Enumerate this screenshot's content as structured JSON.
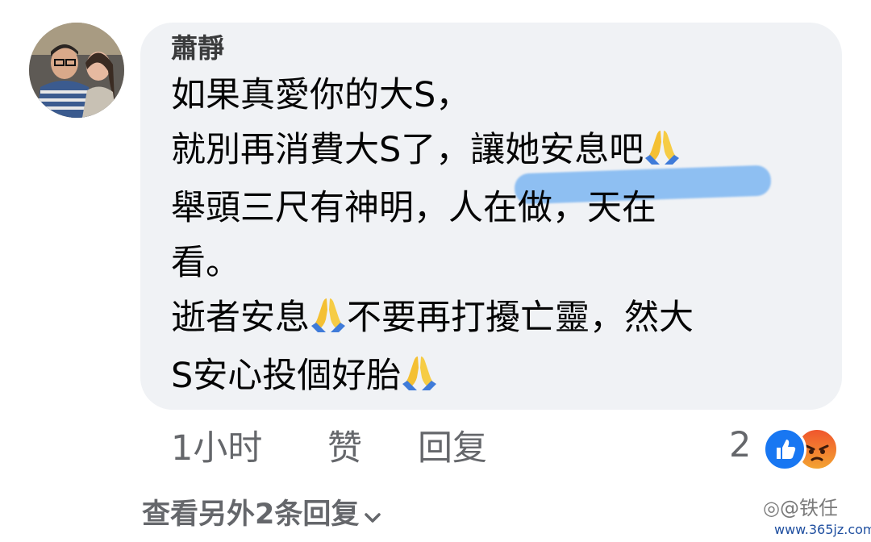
{
  "comment": {
    "author": "蕭靜",
    "lines": {
      "l1": "如果真愛你的大S，",
      "l2": "就別再消費大S了，讓她安息吧",
      "l3": "舉頭三尺有神明，人在做，天在",
      "l4": "看。",
      "l5a": "逝者安息",
      "l5b": "不要再打擾亡靈，然大",
      "l6": "S安心投個好胎"
    },
    "emoji_icon": "folded-hands-icon",
    "highlight_color": "#3e96f0"
  },
  "actions": {
    "time": "1小时",
    "like": "赞",
    "reply": "回复"
  },
  "reactions": {
    "count": "2",
    "icons": [
      "like-icon",
      "angry-icon"
    ]
  },
  "more_replies": {
    "label": "查看另外2条回复"
  },
  "watermark": {
    "text": "◎@铁任",
    "url": "www.365jz.com"
  },
  "colors": {
    "bubble": "#f0f2f5",
    "secondary_text": "#65676b",
    "like_blue": "#1877f2"
  }
}
